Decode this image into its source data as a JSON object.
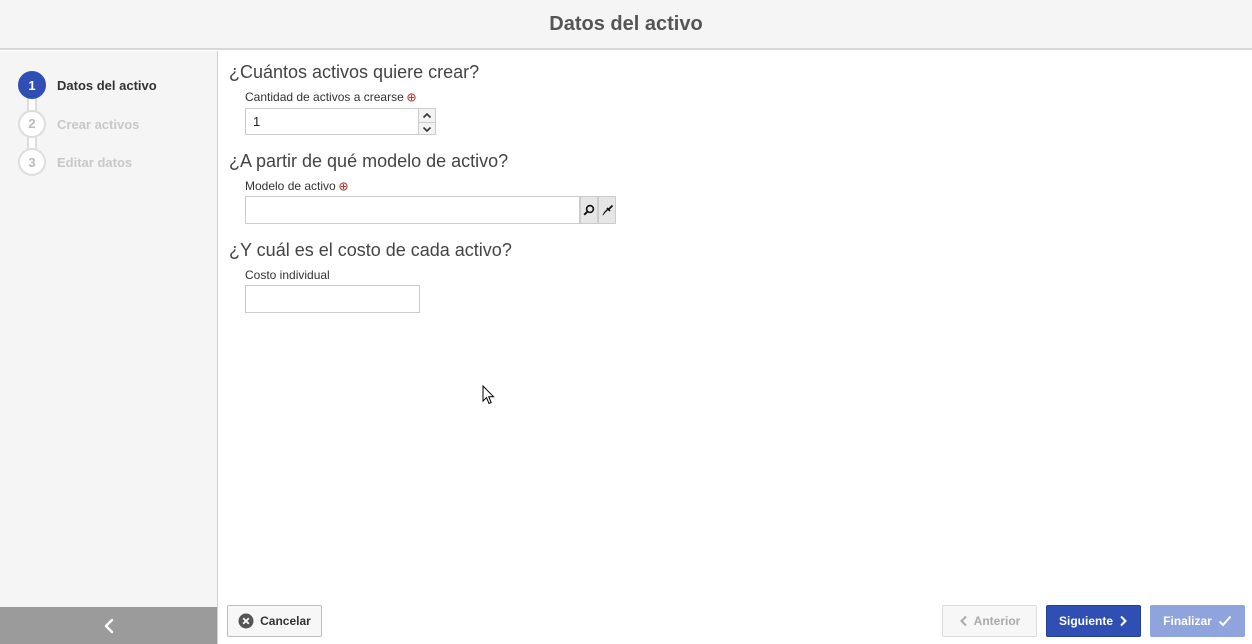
{
  "header": {
    "title": "Datos del activo"
  },
  "steps": [
    {
      "number": "1",
      "label": "Datos del activo",
      "active": true
    },
    {
      "number": "2",
      "label": "Crear activos",
      "active": false
    },
    {
      "number": "3",
      "label": "Editar datos",
      "active": false
    }
  ],
  "sections": {
    "quantity": {
      "title": "¿Cuántos activos quiere crear?",
      "label": "Cantidad de activos a crearse",
      "value": "1"
    },
    "model": {
      "title": "¿A partir de qué modelo de activo?",
      "label": "Modelo de activo",
      "value": ""
    },
    "cost": {
      "title": "¿Y cuál es el costo de cada activo?",
      "label": "Costo individual",
      "value": ""
    }
  },
  "footer": {
    "cancel": "Cancelar",
    "previous": "Anterior",
    "next": "Siguiente",
    "finish": "Finalizar"
  },
  "colors": {
    "accent": "#2f4fb5",
    "accent_disabled": "#8fa3dc",
    "required_marker": "#c0392b"
  },
  "icons": {
    "required": "required-asterisk-icon",
    "search": "magnifier-icon",
    "clear": "broom-icon",
    "spin_up": "chevron-up-icon",
    "spin_down": "chevron-down-icon",
    "cancel": "circle-x-icon",
    "previous": "chevron-left-icon",
    "next": "chevron-right-icon",
    "finish": "checkmark-icon",
    "collapse": "chevron-left-icon"
  }
}
